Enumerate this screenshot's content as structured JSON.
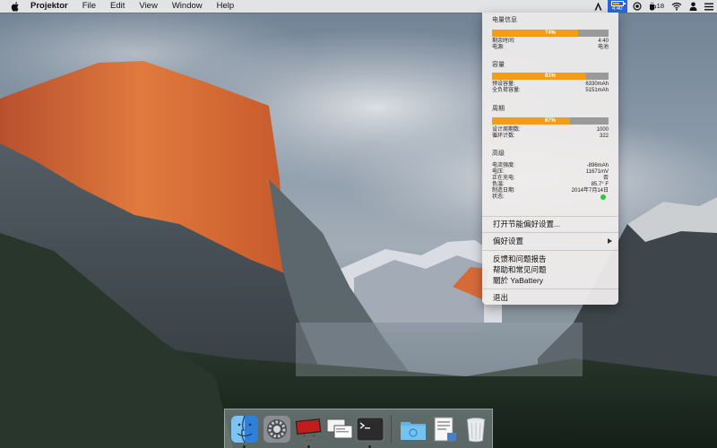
{
  "menubar": {
    "app_name": "Projektor",
    "menus": [
      "File",
      "Edit",
      "View",
      "Window",
      "Help"
    ],
    "battery_time": "4:40",
    "tray_value": "18"
  },
  "battery_menu": {
    "power_info": {
      "title": "电量信息",
      "percent": 74,
      "percent_label": "74%",
      "rows": [
        {
          "key": "剩余时间:",
          "value": "4:40"
        },
        {
          "key": "电源:",
          "value": "电池"
        }
      ]
    },
    "capacity": {
      "title": "容量",
      "percent": 81,
      "percent_label": "81%",
      "rows": [
        {
          "key": "预设容量:",
          "value": "6330mAh"
        },
        {
          "key": "全负荷容量:",
          "value": "5151mAh"
        }
      ]
    },
    "cycles": {
      "title": "周期",
      "percent": 67,
      "percent_label": "67%",
      "rows": [
        {
          "key": "设计周期数:",
          "value": "1000"
        },
        {
          "key": "循环计数:",
          "value": "322"
        }
      ]
    },
    "advanced": {
      "title": "高级",
      "rows": [
        {
          "key": "电流强度:",
          "value": "-896mAh"
        },
        {
          "key": "电压:",
          "value": "11671mV"
        },
        {
          "key": "正在充电:",
          "value": "否"
        },
        {
          "key": "色温:",
          "value": "85.7° F"
        },
        {
          "key": "制造日期:",
          "value": "2014年7月14日"
        },
        {
          "key": "状态:",
          "value": ""
        }
      ]
    },
    "items": {
      "energy_prefs": "打开节能偏好设置...",
      "preferences": "偏好设置",
      "feedback": "反馈和问题报告",
      "help": "帮助和常见问题",
      "about": "關於 YaBattery",
      "quit": "退出"
    }
  },
  "colors": {
    "bar_fill": "#f39c1b",
    "bar_track": "#9a9a9a",
    "status_ok": "#28c840",
    "menu_highlight": "#2a67d5"
  },
  "dock": {
    "apps": [
      "finder-icon",
      "system-preferences-icon",
      "projektor-icon",
      "screens-icon",
      "terminal-icon",
      "folder-icon",
      "preview-icon",
      "trash-icon"
    ]
  }
}
